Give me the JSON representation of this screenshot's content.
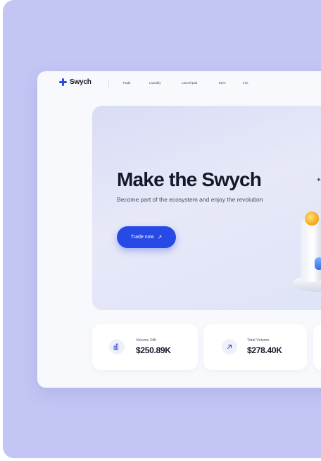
{
  "brand": {
    "name": "Swych",
    "accent_color": "#2749e6",
    "background_color": "#c3c6f4"
  },
  "nav": {
    "links": [
      "Trade",
      "Liquidity",
      "Launchpad",
      "Earn",
      "Info"
    ]
  },
  "hero": {
    "title": "Make the Swych",
    "subtitle": "Become part of the ecosystem and enjoy the revolution",
    "cta_label": "Trade now",
    "cta_icon": "arrow-up-right-icon"
  },
  "stats": [
    {
      "label": "Volume 24h",
      "value": "$250.89K",
      "icon": "bar-chart-icon"
    },
    {
      "label": "Total Volume",
      "value": "$278.40K",
      "icon": "arrow-up-right-icon"
    }
  ]
}
